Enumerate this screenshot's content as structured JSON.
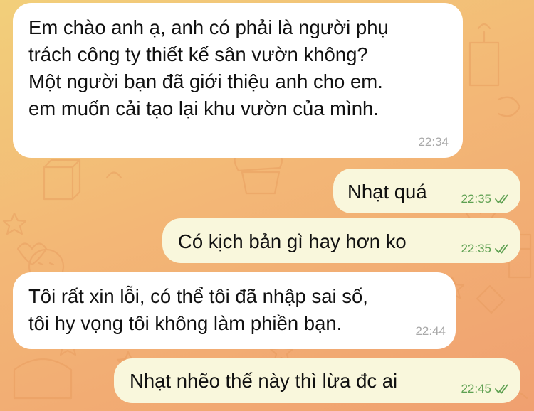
{
  "chat": {
    "messages": [
      {
        "direction": "incoming",
        "lines": [
          "Em chào anh ạ, anh có phải là người phụ",
          "trách công ty thiết kế sân vườn không?",
          "Một người bạn đã giới thiệu anh cho em.",
          "em muốn cải tạo lại khu vườn của mình."
        ],
        "time": "22:34"
      },
      {
        "direction": "outgoing",
        "lines": [
          "Nhạt quá"
        ],
        "time": "22:35",
        "status": "read"
      },
      {
        "direction": "outgoing",
        "lines": [
          "Có kịch bản gì hay hơn ko"
        ],
        "time": "22:35",
        "status": "read"
      },
      {
        "direction": "incoming",
        "lines": [
          "Tôi rất xin lỗi, có thể tôi đã nhập sai số,",
          "tôi hy vọng tôi không làm phiền bạn."
        ],
        "time": "22:44"
      },
      {
        "direction": "outgoing",
        "lines": [
          "Nhạt nhẽo thế này thì lừa đc ai"
        ],
        "time": "22:45",
        "status": "read"
      }
    ]
  },
  "colors": {
    "incoming_bubble": "#ffffff",
    "outgoing_bubble": "#f9f7dc",
    "outgoing_meta": "#5fa152",
    "incoming_meta": "#a9a9a9"
  },
  "icons": {
    "read_status": "double-check-icon"
  }
}
